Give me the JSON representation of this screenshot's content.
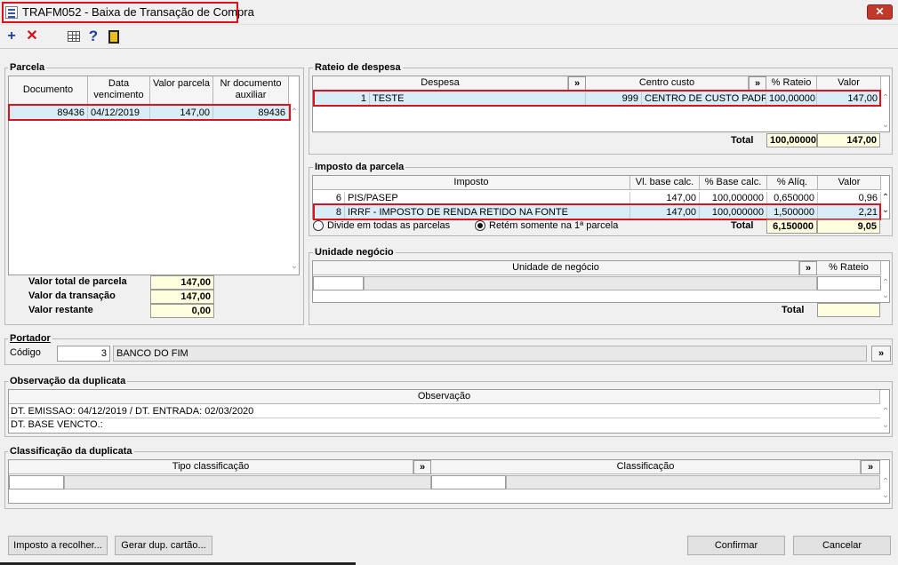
{
  "window": {
    "title": "TRAFM052 - Baixa de Transação de Compra",
    "close_glyph": "✕"
  },
  "toolbar": {
    "add_glyph": "+",
    "delete_glyph": "✕",
    "help_glyph": "?"
  },
  "parcela": {
    "title": "Parcela",
    "headers": {
      "documento": "Documento",
      "data_vencimento": "Data vencimento",
      "valor_parcela": "Valor parcela",
      "nr_doc_aux": "Nr documento auxiliar"
    },
    "rows": [
      {
        "documento": "89436",
        "data_vencimento": "04/12/2019",
        "valor_parcela": "147,00",
        "nr_doc_aux": "89436"
      }
    ],
    "totals": {
      "valor_total_label": "Valor total de parcela",
      "valor_total": "147,00",
      "valor_transacao_label": "Valor da transação",
      "valor_transacao": "147,00",
      "valor_restante_label": "Valor restante",
      "valor_restante": "0,00"
    }
  },
  "rateio": {
    "title": "Rateio de despesa",
    "headers": {
      "despesa": "Despesa",
      "centro_custo": "Centro custo",
      "pct_rateio": "% Rateio",
      "valor": "Valor",
      "arrow": "»"
    },
    "rows": [
      {
        "cod": "1",
        "despesa": "TESTE",
        "cc_cod": "999",
        "centro_custo": "CENTRO DE CUSTO PADRAO",
        "pct_rateio": "100,00000",
        "valor": "147,00"
      }
    ],
    "total_label": "Total",
    "total_pct": "100,00000",
    "total_valor": "147,00"
  },
  "imposto": {
    "title": "Imposto da parcela",
    "headers": {
      "imposto": "Imposto",
      "vl_base": "Vl. base calc.",
      "pct_base": "% Base calc.",
      "pct_aliq": "% Alíq.",
      "valor": "Valor"
    },
    "rows": [
      {
        "cod": "6",
        "imposto": "PIS/PASEP",
        "vl_base": "147,00",
        "pct_base": "100,000000",
        "pct_aliq": "0,650000",
        "valor": "0,96"
      },
      {
        "cod": "8",
        "imposto": "IRRF - IMPOSTO DE RENDA RETIDO NA FONTE",
        "vl_base": "147,00",
        "pct_base": "100,000000",
        "pct_aliq": "1,500000",
        "valor": "2,21"
      }
    ],
    "radio_divide": "Divide em todas as parcelas",
    "radio_retem": "Retém somente na 1ª parcela",
    "total_label": "Total",
    "total_aliq": "6,150000",
    "total_valor": "9,05"
  },
  "unidade": {
    "title": "Unidade negócio",
    "headers": {
      "unidade": "Unidade de negócio",
      "pct_rateio": "% Rateio"
    },
    "total_label": "Total",
    "total_valor": ""
  },
  "portador": {
    "title": "Portador",
    "codigo_label": "Código",
    "codigo": "3",
    "nome": "BANCO DO FIM"
  },
  "observacao": {
    "title": "Observação da duplicata",
    "header": "Observação",
    "lines": [
      "DT. EMISSAO: 04/12/2019 / DT. ENTRADA: 02/03/2020",
      "DT. BASE VENCTO.:"
    ]
  },
  "classificacao": {
    "title": "Classificação da duplicata",
    "headers": {
      "tipo": "Tipo classificação",
      "classificacao": "Classificação"
    }
  },
  "buttons": {
    "imposto_recolher": "Imposto a recolher...",
    "gerar_dup": "Gerar dup. cartão...",
    "confirmar": "Confirmar",
    "cancelar": "Cancelar"
  }
}
